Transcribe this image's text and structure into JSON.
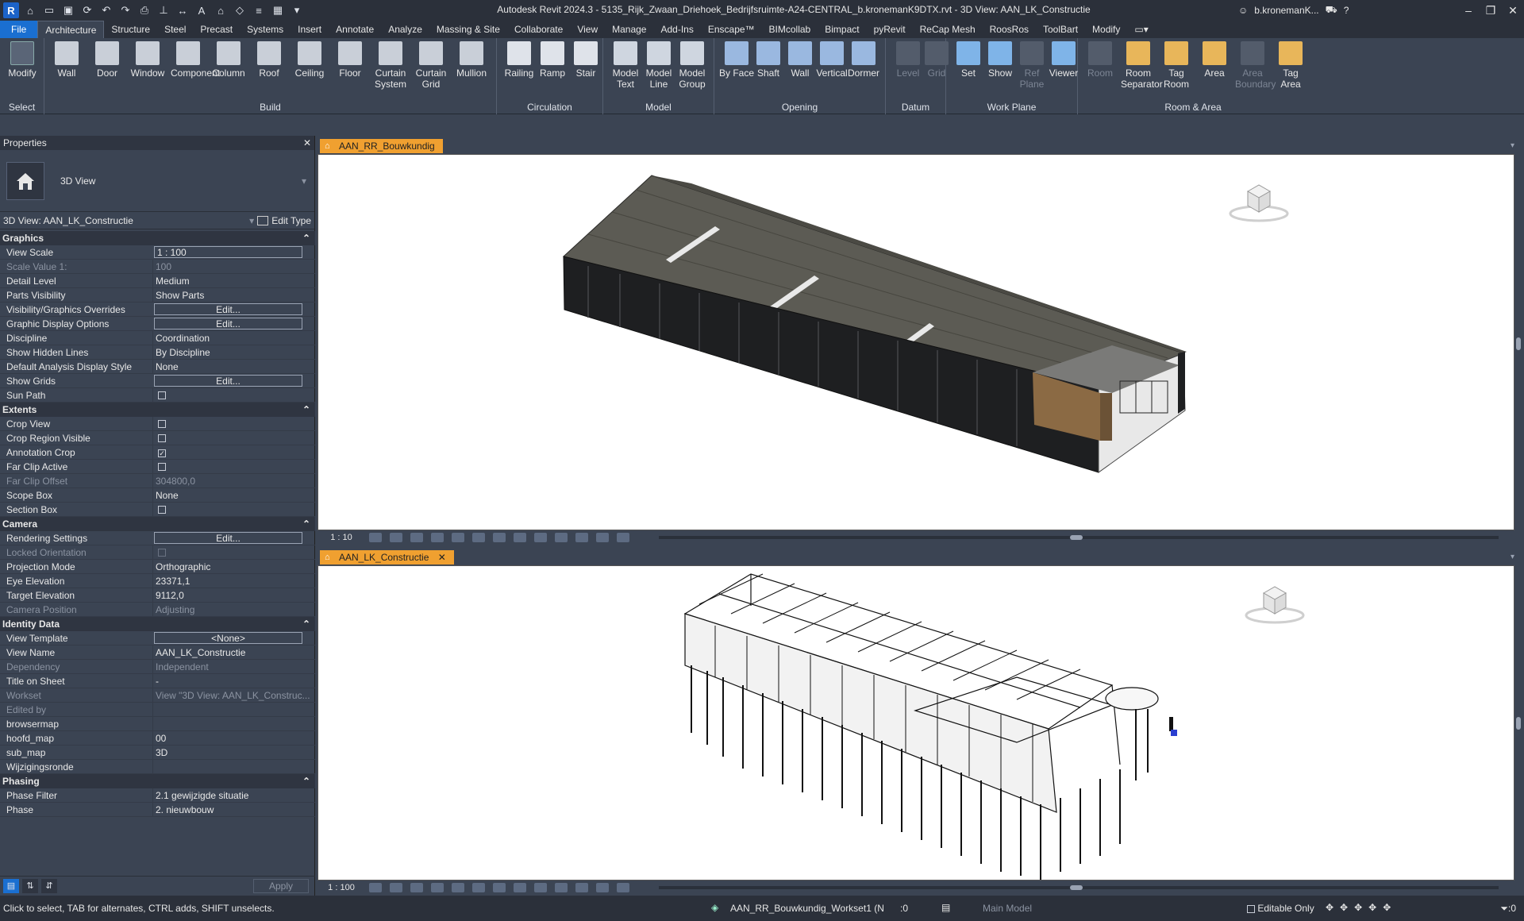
{
  "title": "Autodesk Revit 2024.3 - 5135_Rijk_Zwaan_Driehoek_Bedrijfsruimte-A24-CENTRAL_b.kronemanK9DTX.rvt - 3D View: AAN_LK_Constructie",
  "user": "b.kronemanK...",
  "ribbon_tabs": [
    "File",
    "Architecture",
    "Structure",
    "Steel",
    "Precast",
    "Systems",
    "Insert",
    "Annotate",
    "Analyze",
    "Massing & Site",
    "Collaborate",
    "View",
    "Manage",
    "Add-Ins",
    "Enscape™",
    "BIMcollab",
    "Bimpact",
    "pyRevit",
    "ReCap Mesh",
    "RoosRos",
    "ToolBart",
    "Modify"
  ],
  "ribbon_groups": {
    "select": {
      "label": "Select",
      "buttons": [
        "Modify"
      ]
    },
    "build": {
      "label": "Build",
      "buttons": [
        "Wall",
        "Door",
        "Window",
        "Component",
        "Column",
        "Roof",
        "Ceiling",
        "Floor",
        "Curtain System",
        "Curtain Grid",
        "Mullion"
      ]
    },
    "circulation": {
      "label": "Circulation",
      "buttons": [
        "Railing",
        "Ramp",
        "Stair"
      ]
    },
    "model": {
      "label": "Model",
      "buttons": [
        "Model Text",
        "Model Line",
        "Model Group"
      ]
    },
    "opening": {
      "label": "Opening",
      "buttons": [
        "By Face",
        "Shaft",
        "Wall",
        "Vertical",
        "Dormer"
      ]
    },
    "datum": {
      "label": "Datum",
      "buttons": [
        "Level",
        "Grid"
      ]
    },
    "workplane": {
      "label": "Work Plane",
      "buttons": [
        "Set",
        "Show",
        "Ref Plane",
        "Viewer"
      ]
    },
    "roomarea": {
      "label": "Room & Area",
      "buttons": [
        "Room",
        "Room Separator",
        "Tag Room",
        "Area",
        "Area Boundary",
        "Tag Area"
      ]
    }
  },
  "properties": {
    "header": "Properties",
    "type_name": "3D View",
    "instance": "3D View: AAN_LK_Constructie",
    "edit_type": "Edit Type",
    "apply": "Apply",
    "sections": [
      {
        "name": "Graphics",
        "rows": [
          [
            "View Scale",
            "1 : 100",
            "boxl"
          ],
          [
            "Scale Value    1:",
            "100",
            "ro"
          ],
          [
            "Detail Level",
            "Medium",
            ""
          ],
          [
            "Parts Visibility",
            "Show Parts",
            ""
          ],
          [
            "Visibility/Graphics Overrides",
            "Edit...",
            "box"
          ],
          [
            "Graphic Display Options",
            "Edit...",
            "box"
          ],
          [
            "Discipline",
            "Coordination",
            ""
          ],
          [
            "Show Hidden Lines",
            "By Discipline",
            ""
          ],
          [
            "Default Analysis Display Style",
            "None",
            ""
          ],
          [
            "Show Grids",
            "Edit...",
            "box"
          ],
          [
            "Sun Path",
            "",
            "cb"
          ]
        ]
      },
      {
        "name": "Extents",
        "rows": [
          [
            "Crop View",
            "",
            "cb"
          ],
          [
            "Crop Region Visible",
            "",
            "cb"
          ],
          [
            "Annotation Crop",
            "✓",
            "cb"
          ],
          [
            "Far Clip Active",
            "",
            "cb"
          ],
          [
            "Far Clip Offset",
            "304800,0",
            "ro"
          ],
          [
            "Scope Box",
            "None",
            ""
          ],
          [
            "Section Box",
            "",
            "cb"
          ]
        ]
      },
      {
        "name": "Camera",
        "rows": [
          [
            "Rendering Settings",
            "Edit...",
            "box"
          ],
          [
            "Locked Orientation",
            "",
            "rocb"
          ],
          [
            "Projection Mode",
            "Orthographic",
            ""
          ],
          [
            "Eye Elevation",
            "23371,1",
            ""
          ],
          [
            "Target Elevation",
            "9112,0",
            ""
          ],
          [
            "Camera Position",
            "Adjusting",
            "ro"
          ]
        ]
      },
      {
        "name": "Identity Data",
        "rows": [
          [
            "View Template",
            "<None>",
            "box"
          ],
          [
            "View Name",
            "AAN_LK_Constructie",
            ""
          ],
          [
            "Dependency",
            "Independent",
            "ro"
          ],
          [
            "Title on Sheet",
            "-",
            ""
          ],
          [
            "Workset",
            "View \"3D View: AAN_LK_Construc...",
            "ro"
          ],
          [
            "Edited by",
            "",
            "ro"
          ],
          [
            "browsermap",
            "",
            ""
          ],
          [
            "hoofd_map",
            "00",
            ""
          ],
          [
            "sub_map",
            "3D",
            ""
          ],
          [
            "Wijzigingsronde",
            "",
            ""
          ]
        ]
      },
      {
        "name": "Phasing",
        "rows": [
          [
            "Phase Filter",
            "2.1 gewijzigde situatie",
            ""
          ],
          [
            "Phase",
            "2. nieuwbouw",
            ""
          ]
        ]
      }
    ]
  },
  "views": {
    "top": {
      "tab": "AAN_RR_Bouwkundig",
      "scale": "1 : 10"
    },
    "bottom": {
      "tab": "AAN_LK_Constructie",
      "scale": "1 : 100"
    }
  },
  "status": {
    "message": "Click to select, TAB for alternates, CTRL adds, SHIFT unselects.",
    "workset": "AAN_RR_Bouwkundig_Workset1 (N",
    "workset_count": ":0",
    "model": "Main Model",
    "editable_only": "Editable Only",
    "filter_count": ":0"
  },
  "colors": {
    "accent": "#1a6fd1",
    "view_tab": "#f0a030",
    "bg": "#3b4453"
  }
}
